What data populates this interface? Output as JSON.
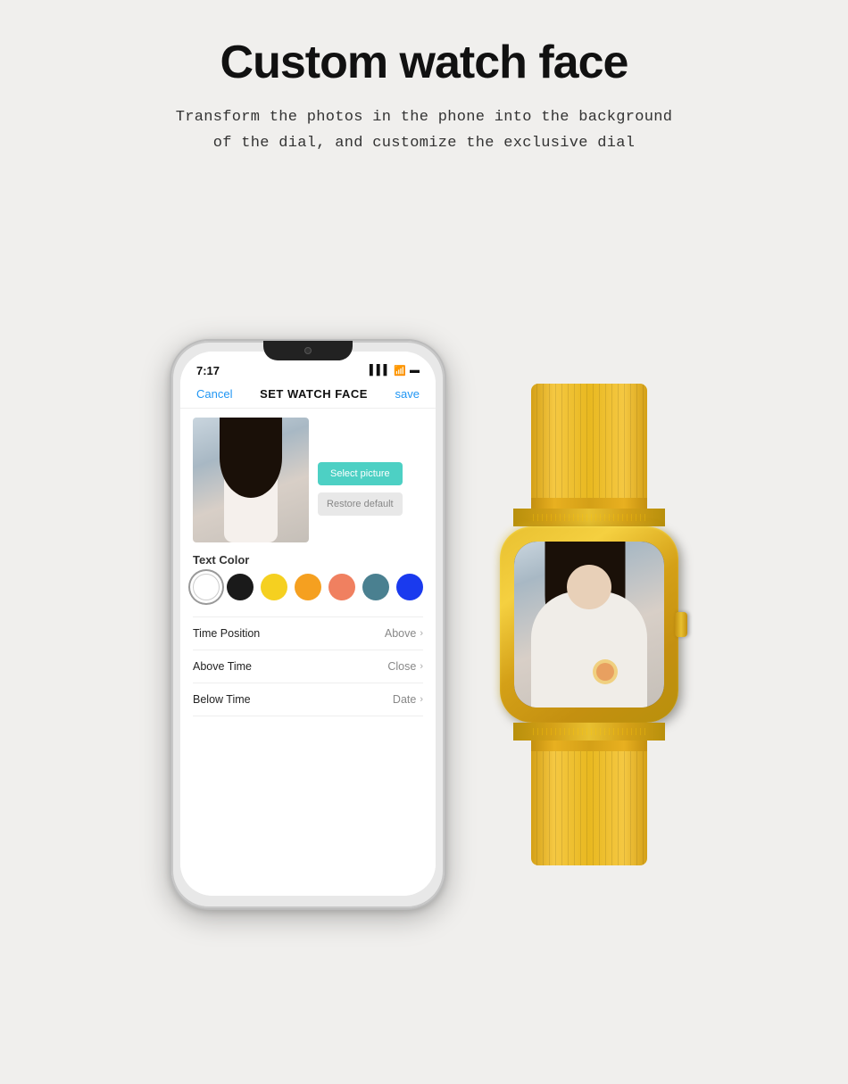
{
  "page": {
    "title": "Custom watch face",
    "subtitle_line1": "Transform the photos in the phone into the background",
    "subtitle_line2": "of the dial, and customize the exclusive dial"
  },
  "phone": {
    "status": {
      "time": "7:17"
    },
    "nav": {
      "cancel": "Cancel",
      "title": "SET WATCH FACE",
      "save": "save"
    },
    "buttons": {
      "select": "Select picture",
      "restore": "Restore default"
    },
    "text_color": {
      "label": "Text Color",
      "colors": [
        {
          "name": "white",
          "hex": "#ffffff",
          "selected": true
        },
        {
          "name": "black",
          "hex": "#1a1a1a"
        },
        {
          "name": "yellow",
          "hex": "#f5d020"
        },
        {
          "name": "orange",
          "hex": "#f5a020"
        },
        {
          "name": "salmon",
          "hex": "#f08060"
        },
        {
          "name": "teal",
          "hex": "#4a8090"
        },
        {
          "name": "blue",
          "hex": "#1a3aee"
        }
      ]
    },
    "settings": [
      {
        "label": "Time Position",
        "value": "Above"
      },
      {
        "label": "Above Time",
        "value": "Close"
      },
      {
        "label": "Below Time",
        "value": "Date"
      }
    ]
  },
  "watch": {
    "band_color": "#d4a017",
    "body_color": "#d4a017"
  }
}
